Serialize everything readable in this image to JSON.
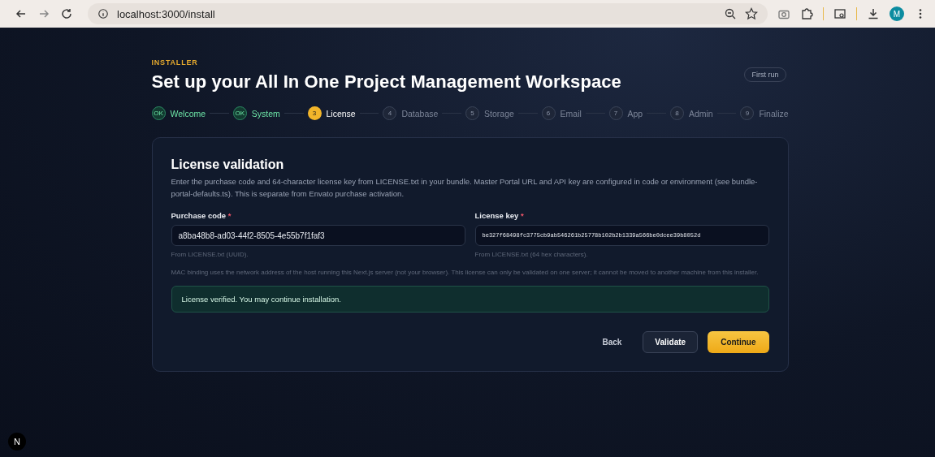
{
  "browser": {
    "url": "localhost:3000/install",
    "profile_initial": "M"
  },
  "header": {
    "eyebrow": "INSTALLER",
    "title": "Set up your All In One Project Management Workspace",
    "badge": "First run"
  },
  "steps": [
    {
      "badge": "OK",
      "label": "Welcome",
      "completed": true,
      "selected": false
    },
    {
      "badge": "OK",
      "label": "System",
      "completed": true,
      "selected": false
    },
    {
      "badge": "3",
      "label": "License",
      "completed": false,
      "selected": true
    },
    {
      "badge": "4",
      "label": "Database",
      "completed": false,
      "selected": false
    },
    {
      "badge": "5",
      "label": "Storage",
      "completed": false,
      "selected": false
    },
    {
      "badge": "6",
      "label": "Email",
      "completed": false,
      "selected": false
    },
    {
      "badge": "7",
      "label": "App",
      "completed": false,
      "selected": false
    },
    {
      "badge": "8",
      "label": "Admin",
      "completed": false,
      "selected": false
    },
    {
      "badge": "9",
      "label": "Finalize",
      "completed": false,
      "selected": false
    }
  ],
  "card": {
    "title": "License validation",
    "description": "Enter the purchase code and 64-character license key from LICENSE.txt in your bundle. Master Portal URL and API key are configured in code or environment (see bundle-portal-defaults.ts). This is separate from Envato purchase activation.",
    "fields": [
      {
        "label": "Purchase code",
        "required_mark": "*",
        "value": "a8ba48b8-ad03-44f2-8505-4e55b7f1faf3",
        "hint": "From LICENSE.txt (UUID).",
        "kind": "text"
      },
      {
        "label": "License key",
        "required_mark": "*",
        "value": "be327f68498fc3775cb9ab546261b25778b102b2b1339a566be0dcee39b8052d",
        "hint": "From LICENSE.txt (64 hex characters).",
        "kind": "mono"
      }
    ],
    "note": "MAC binding uses the network address of the host running this Next.js server (not your browser). This license can only be validated on one server; it cannot be moved to another machine from this installer.",
    "alert": {
      "kind": "success",
      "text": "License verified. You may continue installation."
    },
    "buttons": [
      {
        "label": "Back",
        "kind": "ghost"
      },
      {
        "label": "Validate",
        "kind": "secondary"
      },
      {
        "label": "Continue",
        "kind": "primary"
      }
    ]
  },
  "dev_badge": "N"
}
